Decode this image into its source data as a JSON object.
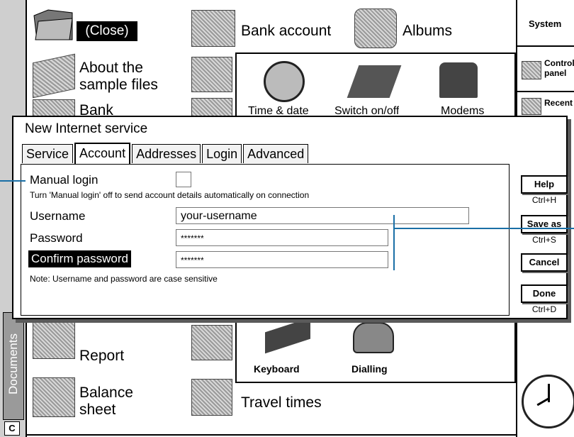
{
  "desktop": {
    "close_label": "(Close)",
    "bank_account": "Bank account",
    "albums": "Albums",
    "about_line1": "About the",
    "about_line2": "sample files",
    "bank_partial": "Bank",
    "report": "Report",
    "balance_line1": "Balance",
    "balance_line2": "sheet",
    "travel_times": "Travel times",
    "documents_tab": "Documents"
  },
  "control_panel": {
    "time_date": "Time & date",
    "switch_onoff": "Switch on/off",
    "modems": "Modems",
    "keyboard": "Keyboard",
    "dialling": "Dialling"
  },
  "right_bar": {
    "system": "System",
    "control_line1": "Control",
    "control_line2": "panel",
    "recent_partial": "Recent"
  },
  "dialog": {
    "title": "New Internet service",
    "tabs": [
      "Service",
      "Account",
      "Addresses",
      "Login",
      "Advanced"
    ],
    "active_tab": "Account",
    "manual_login_label": "Manual login",
    "manual_login_hint": "Turn 'Manual login' off to send account details automatically on connection",
    "username_label": "Username",
    "username_value": "your-username",
    "password_label": "Password",
    "password_value": "*******",
    "confirm_label": "Confirm password",
    "confirm_value": "*******",
    "note": "Note: Username and password are case sensitive",
    "buttons": [
      {
        "label": "Help",
        "shortcut": "Ctrl+H"
      },
      {
        "label": "Save as",
        "shortcut": "Ctrl+S"
      },
      {
        "label": "Cancel",
        "shortcut": ""
      },
      {
        "label": "Done",
        "shortcut": "Ctrl+D"
      }
    ]
  },
  "colors": {
    "callout": "#1a6fa6",
    "shadow": "#5a5a5a"
  }
}
